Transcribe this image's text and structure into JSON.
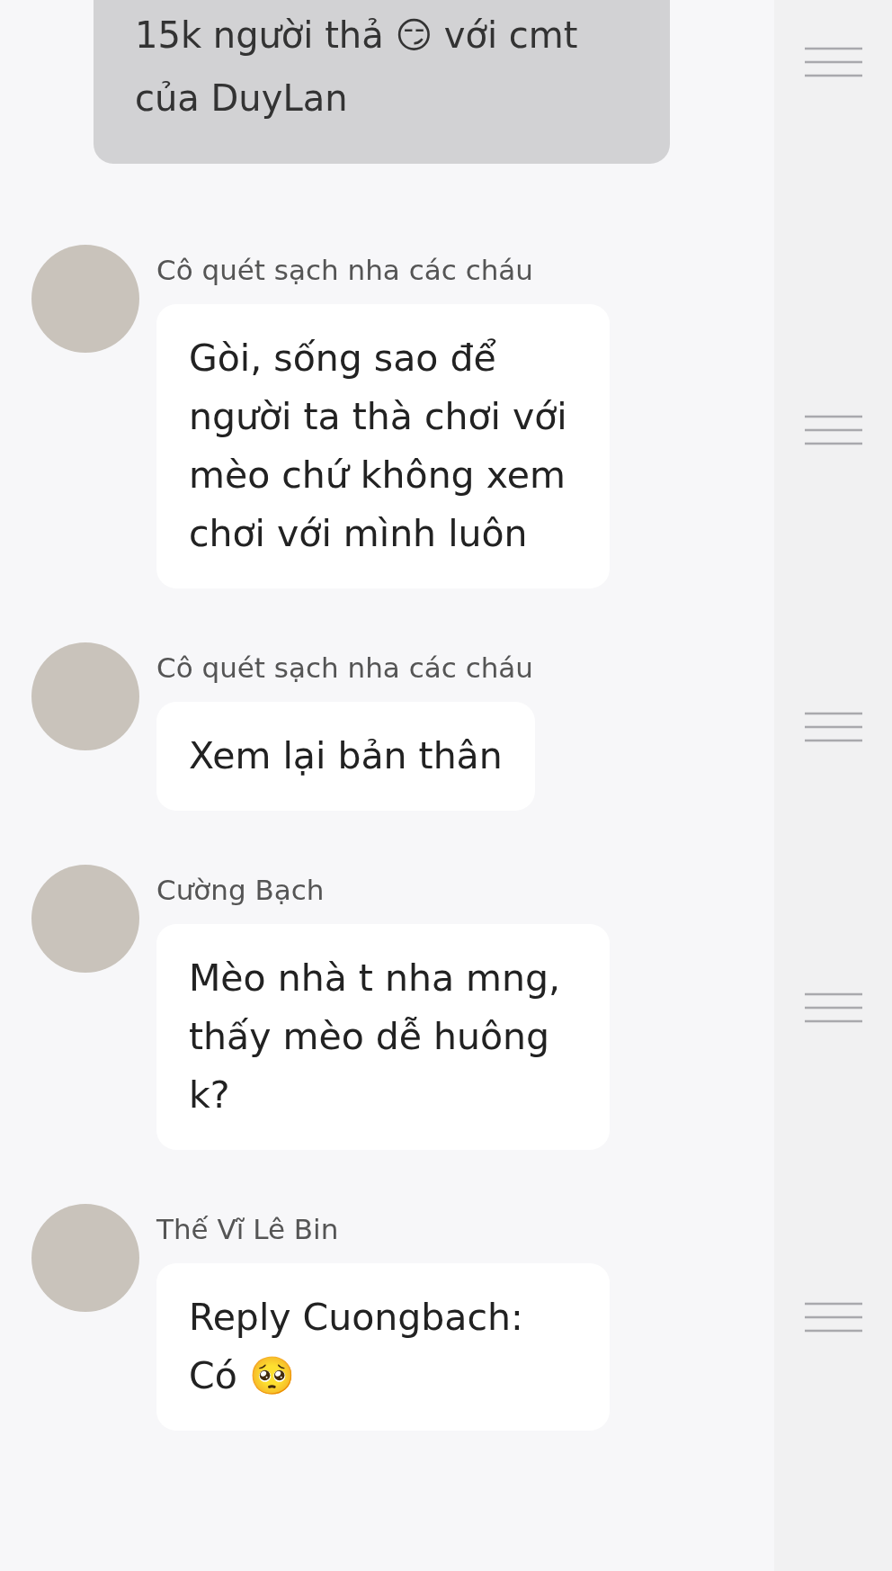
{
  "messages": [
    {
      "kind": "quote",
      "text": "15k người thả 😏 với cmt của DuyLan"
    },
    {
      "kind": "message",
      "author": "Cô quét sạch nha các cháu",
      "text": "Gòi, sống sao để người ta thà chơi với mèo chứ không xem chơi với mình luôn"
    },
    {
      "kind": "message",
      "author": "Cô quét sạch nha các cháu",
      "text": "Xem lại bản thân"
    },
    {
      "kind": "message",
      "author": "Cường Bạch",
      "text": "Mèo nhà t nha mng, thấy mèo dễ huông k?"
    },
    {
      "kind": "message",
      "author": "Thế Vĩ Lê Bin",
      "text": "Reply Cuongbach: Có 🥺"
    }
  ]
}
